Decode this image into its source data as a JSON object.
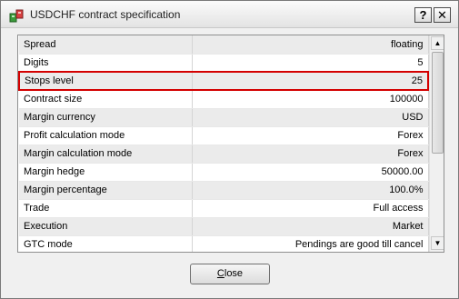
{
  "window": {
    "title": "USDCHF contract specification",
    "help_button": "?",
    "close_button": "✕"
  },
  "spec_rows": [
    {
      "key": "Spread",
      "value": "floating"
    },
    {
      "key": "Digits",
      "value": "5"
    },
    {
      "key": "Stops level",
      "value": "25",
      "highlighted": true
    },
    {
      "key": "Contract size",
      "value": "100000"
    },
    {
      "key": "Margin currency",
      "value": "USD"
    },
    {
      "key": "Profit calculation mode",
      "value": "Forex"
    },
    {
      "key": "Margin calculation mode",
      "value": "Forex"
    },
    {
      "key": "Margin hedge",
      "value": "50000.00"
    },
    {
      "key": "Margin percentage",
      "value": "100.0%"
    },
    {
      "key": "Trade",
      "value": "Full access"
    },
    {
      "key": "Execution",
      "value": "Market"
    },
    {
      "key": "GTC mode",
      "value": "Pendings are good till cancel"
    }
  ],
  "scrollbar": {
    "up_arrow": "▲",
    "down_arrow": "▼"
  },
  "footer": {
    "close_label_underlined": "C",
    "close_label_rest": "lose"
  },
  "colors": {
    "highlight": "#d40000",
    "row_alt": "#ebebeb"
  }
}
